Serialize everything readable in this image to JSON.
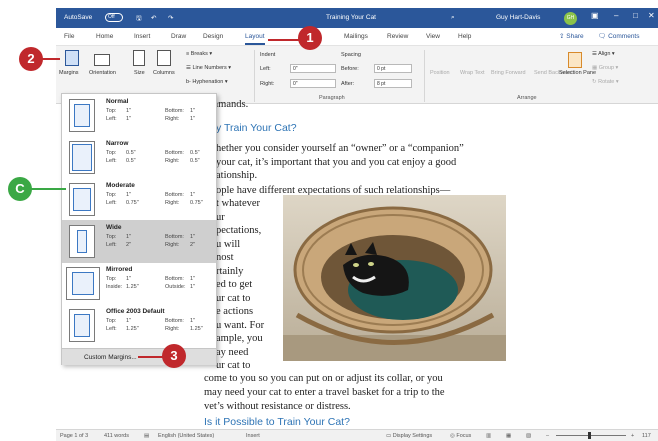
{
  "titlebar": {
    "autosave": "AutoSave",
    "autosave_state": "Off",
    "doc_title": "Training Your Cat",
    "user_name": "Guy Hart-Davis",
    "user_initials": "GH"
  },
  "tabs": [
    "File",
    "Home",
    "Insert",
    "Draw",
    "Design",
    "Layout",
    "Mailings",
    "Review",
    "View",
    "Help"
  ],
  "active_tab": "Layout",
  "share_label": "Share",
  "comments_label": "Comments",
  "ribbon": {
    "margins": "Margins",
    "orientation": "Orientation",
    "size": "Size",
    "columns": "Columns",
    "breaks": "Breaks",
    "line_numbers": "Line Numbers",
    "hyphenation": "Hyphenation",
    "indent_title": "Indent",
    "indent_left_label": "Left:",
    "indent_left_value": "0\"",
    "indent_right_label": "Right:",
    "indent_right_value": "0\"",
    "spacing_title": "Spacing",
    "before_label": "Before:",
    "before_value": "0 pt",
    "after_label": "After:",
    "after_value": "8 pt",
    "paragraph_group": "Paragraph",
    "arrange_group": "Arrange",
    "position": "Position",
    "wrap_text": "Wrap Text",
    "bring_forward": "Bring Forward",
    "send_backward": "Send Backward",
    "selection_pane": "Selection Pane",
    "align": "Align",
    "group": "Group",
    "rotate": "Rotate"
  },
  "margins_menu": {
    "options": [
      {
        "name": "Normal",
        "top": "1\"",
        "bottom": "1\"",
        "left": "1\"",
        "right": "1\"",
        "lk": "Left:",
        "rk": "Right:"
      },
      {
        "name": "Narrow",
        "top": "0.5\"",
        "bottom": "0.5\"",
        "left": "0.5\"",
        "right": "0.5\"",
        "lk": "Left:",
        "rk": "Right:"
      },
      {
        "name": "Moderate",
        "top": "1\"",
        "bottom": "1\"",
        "left": "0.75\"",
        "right": "0.75\"",
        "lk": "Left:",
        "rk": "Right:"
      },
      {
        "name": "Wide",
        "top": "1\"",
        "bottom": "1\"",
        "left": "2\"",
        "right": "2\"",
        "lk": "Left:",
        "rk": "Right:"
      },
      {
        "name": "Mirrored",
        "top": "1\"",
        "bottom": "1\"",
        "left": "1.25\"",
        "right": "1\"",
        "lk": "Inside:",
        "rk": "Outside:"
      },
      {
        "name": "Office 2003 Default",
        "top": "1\"",
        "bottom": "1\"",
        "left": "1.25\"",
        "right": "1.25\"",
        "lk": "Left:",
        "rk": "Right:"
      }
    ],
    "top_key": "Top:",
    "bottom_key": "Bottom:",
    "custom_margins": "Custom Margins..."
  },
  "callouts": {
    "one": "1",
    "two": "2",
    "three": "3",
    "c": "C"
  },
  "document": {
    "frag_top": "mmands.",
    "heading1": "y Train Your Cat?",
    "p1": [
      "hether you consider yourself an “owner” or a “companion”",
      "your cat, it’s important that you and you cat enjoy a good",
      "ationship."
    ],
    "p2_first": "ople have different expectations of such relationships—",
    "p2_wrap": [
      "t whatever",
      "ur",
      "pectations,",
      "u will",
      "nost",
      "rtainly",
      "ed to get",
      "ur cat to",
      "e actions",
      "u want. For",
      "ample, you",
      "ay need",
      "ur cat to"
    ],
    "p2_tail": [
      "come to you so you can put on or adjust its collar, or you",
      "may need your cat to enter a travel basket for a trip to the",
      "vet’s without resistance or distress."
    ],
    "heading2": "Is it Possible to Train Your Cat?"
  },
  "status": {
    "page": "Page 1 of 3",
    "words": "411 words",
    "language": "English (United States)",
    "insert": "Insert",
    "display_settings": "Display Settings",
    "focus": "Focus",
    "zoom": "117"
  }
}
